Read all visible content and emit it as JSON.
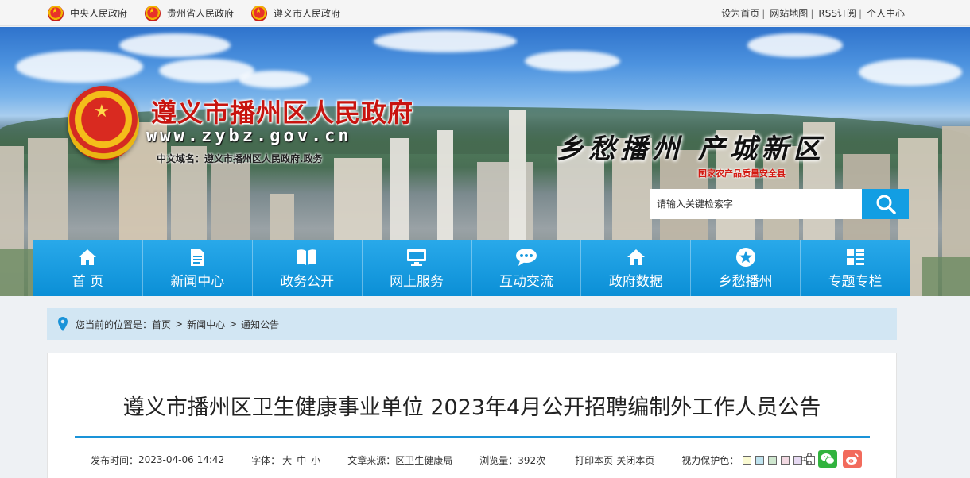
{
  "top_links": [
    "中央人民政府",
    "贵州省人民政府",
    "遵义市人民政府"
  ],
  "right_links": [
    "设为首页",
    "网站地图",
    "RSS订阅",
    "个人中心"
  ],
  "banner": {
    "title": "遵义市播州区人民政府",
    "domain": "www.zybz.gov.cn",
    "cn_domain": "中文域名：遵义市播州区人民政府.政务",
    "slogan": "乡愁播州  产城新区",
    "slogan_sub": "国家农产品质量安全县"
  },
  "search": {
    "placeholder": "请输入关键检索字"
  },
  "nav": [
    {
      "label": "首 页",
      "icon": "home-icon"
    },
    {
      "label": "新闻中心",
      "icon": "document-icon"
    },
    {
      "label": "政务公开",
      "icon": "book-icon"
    },
    {
      "label": "网上服务",
      "icon": "monitor-icon"
    },
    {
      "label": "互动交流",
      "icon": "chat-icon"
    },
    {
      "label": "政府数据",
      "icon": "house-data-icon"
    },
    {
      "label": "乡愁播州",
      "icon": "star-icon"
    },
    {
      "label": "专题专栏",
      "icon": "grid-icon"
    }
  ],
  "breadcrumb": {
    "prefix": "您当前的位置是：",
    "items": [
      "首页",
      "新闻中心",
      "通知公告"
    ]
  },
  "article": {
    "title": "遵义市播州区卫生健康事业单位 2023年4月公开招聘编制外工作人员公告",
    "publish_label": "发布时间：",
    "publish_time": "2023-04-06 14:42",
    "font_label": "字体：",
    "font_sizes": [
      "大",
      "中",
      "小"
    ],
    "source_label": "文章来源：",
    "source": "区卫生健康局",
    "views_label": "浏览量：",
    "views": "392次",
    "print_label": "打印本页",
    "close_label": "关闭本页",
    "eye_label": "视力保护色：",
    "eye_colors": [
      "#fafad2",
      "#bfe3ef",
      "#cfe7cf",
      "#f2d9e2",
      "#e6d9f2",
      "#ffffff"
    ]
  }
}
